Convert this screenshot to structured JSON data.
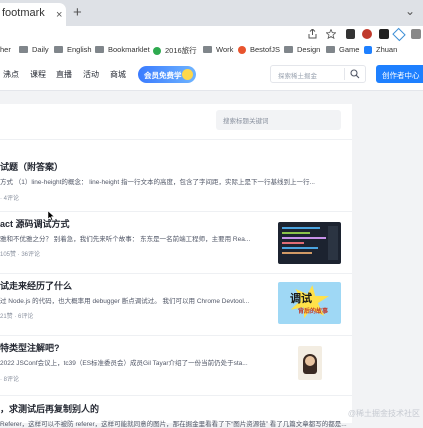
{
  "browser": {
    "tab_title": "footmark",
    "tab_close": "×",
    "new_tab": "+",
    "window_control": "⌄",
    "bookmarks": [
      "her",
      "Daily",
      "English",
      "Bookmarklet",
      "2016旅行",
      "Work",
      "BestofJS",
      "Design",
      "Game",
      "Zhuan"
    ]
  },
  "nav": {
    "items": [
      "沸点",
      "课程",
      "直播",
      "活动",
      "商城"
    ],
    "vip_label": "会员免费学",
    "search_placeholder": "探索稀土掘金",
    "create_label": "创作者中心"
  },
  "panel": {
    "search_placeholder": "搜索标题关键词"
  },
  "articles": [
    {
      "title": "试题（附答案）",
      "abstract": "方式 （1）line-height的概念： line-height 指一行文本的高度，包含了字间距，实际上是下一行基线到上一行...",
      "meta": "· 4评论"
    },
    {
      "title": "act 源码调试方式",
      "abstract": "雅和不优雅之分？ 别着急，我们先来听个故事： 东东是一名前端工程师，主要用 Rea...",
      "meta": "105赞 · 36评论"
    },
    {
      "title": "试走来经历了什么",
      "abstract": "过 Node.js 的代码，也大概率用 debugger 断点调试过。 我们可以用 Chrome Devtool...",
      "meta": "21赞 · 6评论"
    },
    {
      "title": "特类型注解吧?",
      "abstract": "2022 JSConf会议上，tc39（ES标准委员会）成员Gil Tayar介绍了一份当前仍处于sta...",
      "meta": "· 8评论"
    },
    {
      "title": "，求测试后再复制别人的",
      "abstract": "Referer，这样可以不被防 referer，这样可能就同意的图片，那在掘金里看看了下“图片资源链” 看了几篇文章都写的都是...",
      "meta": ""
    }
  ],
  "thumb_texts": [
    "调试",
    "背后的故事"
  ],
  "watermark": "@稀土掘金技术社区",
  "colors": {
    "accent": "#1e80ff",
    "bg": "#f2f3f5"
  }
}
